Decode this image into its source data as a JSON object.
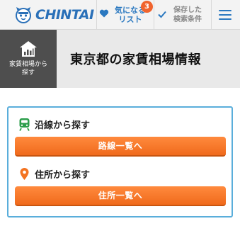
{
  "header": {
    "logo_text": "CHINTAI",
    "favorites": {
      "label_line1": "気になる",
      "label_line2": "リスト",
      "count": "3"
    },
    "saved": {
      "label_line1": "保存した",
      "label_line2": "検索条件"
    },
    "colors": {
      "brand": "#2a70b8",
      "badge": "#f0642e"
    }
  },
  "band": {
    "tab_label_line1": "家賃相場から",
    "tab_label_line2": "探す",
    "title": "東京都の家賃相場情報"
  },
  "search": {
    "line": {
      "label": "沿線から探す",
      "button_label": "路線一覧へ",
      "icon": "train-icon"
    },
    "address": {
      "label": "住所から探す",
      "button_label": "住所一覧へ",
      "icon": "map-pin-icon"
    },
    "colors": {
      "accent": "#f37321",
      "border": "#5aaedb"
    }
  }
}
